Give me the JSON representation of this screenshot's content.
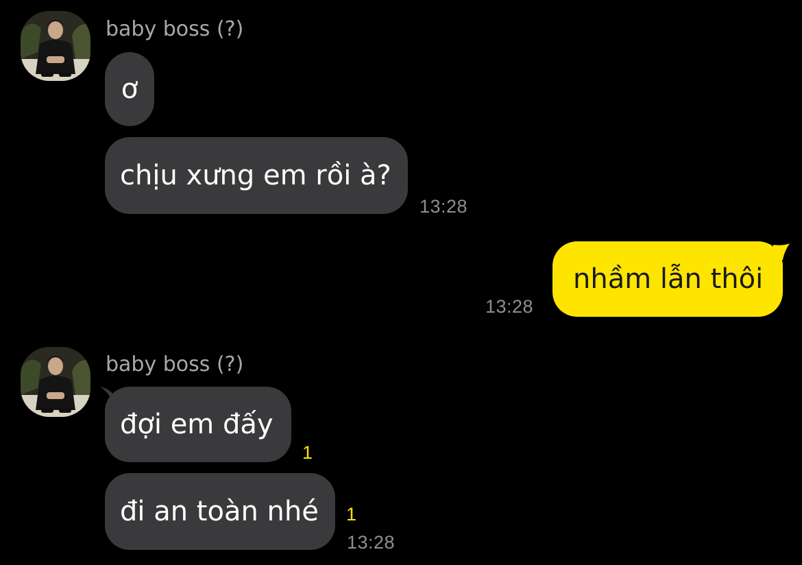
{
  "colors": {
    "background": "#000000",
    "incoming_bubble": "#3a3a3c",
    "outgoing_bubble": "#fee500",
    "timestamp": "#8e8e93",
    "sender_name": "#a8a8a8",
    "unread_count": "#fee500"
  },
  "groups": [
    {
      "sender": "baby boss (?)",
      "avatar_icon": "profile-photo",
      "messages": [
        {
          "text": "ơ"
        },
        {
          "text": "chịu xưng em rồi à?",
          "time": "13:28"
        }
      ]
    },
    {
      "outgoing": true,
      "messages": [
        {
          "text": "nhầm lẫn thôi",
          "time": "13:28"
        }
      ]
    },
    {
      "sender": "baby boss (?)",
      "avatar_icon": "profile-photo",
      "messages": [
        {
          "text": "đợi em đấy",
          "unread": "1"
        },
        {
          "text": "đi an toàn nhé",
          "unread": "1",
          "time": "13:28"
        }
      ]
    }
  ]
}
